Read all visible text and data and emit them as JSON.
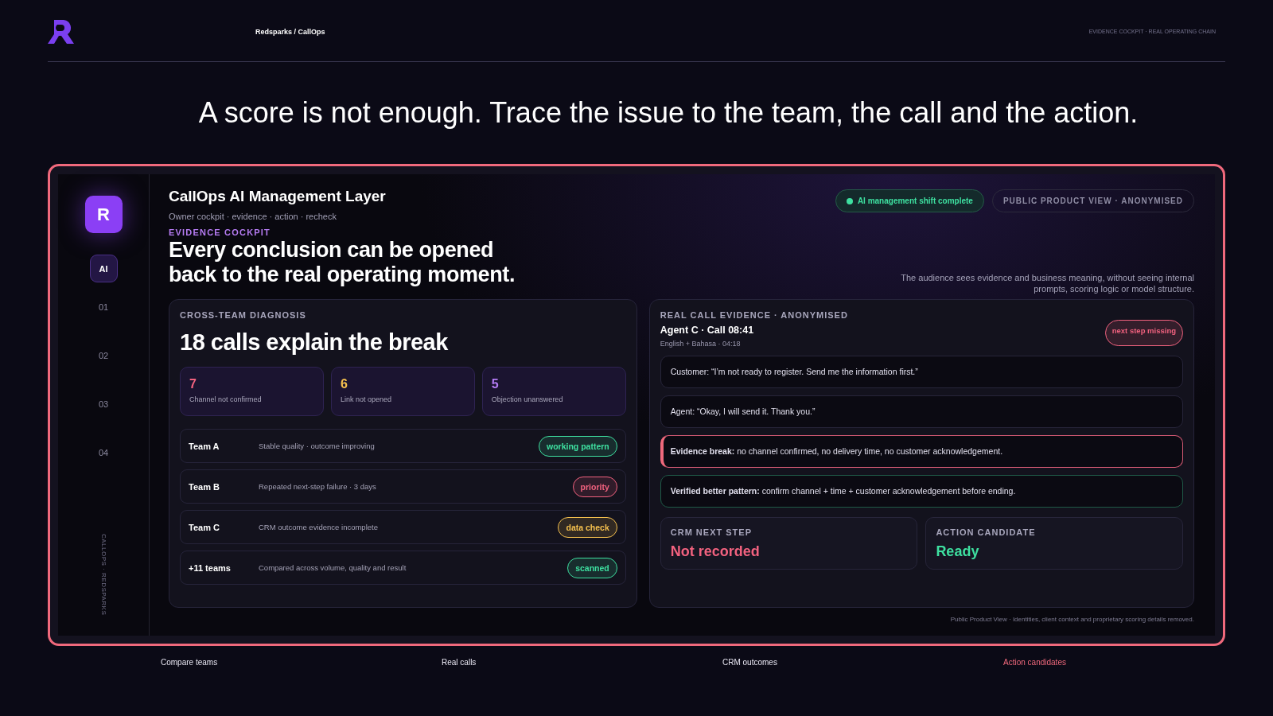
{
  "header": {
    "breadcrumb": "Redsparks / CallOps",
    "caption": "EVIDENCE COCKPIT · REAL OPERATING CHAIN"
  },
  "headline": "A score is not enough. Trace the issue to the team, the call and the action.",
  "sidebar": {
    "logo": "R",
    "items": [
      {
        "label": "AI",
        "selected": true
      },
      {
        "label": "01",
        "selected": false
      },
      {
        "label": "02",
        "selected": false
      },
      {
        "label": "03",
        "selected": false
      },
      {
        "label": "04",
        "selected": false
      }
    ],
    "vertical_caption": "CALLOPS · REDSPARKS"
  },
  "cockpit": {
    "title": "CallOps AI Management Layer",
    "subtitle": "Owner cockpit · evidence · action · recheck",
    "eyebrow": "EVIDENCE COCKPIT",
    "heading_lines": [
      "Every conclusion can be opened",
      "back to the real operating moment."
    ],
    "status_pill": {
      "label": "AI management shift complete",
      "color": "#3ee0a0"
    },
    "view_pill": "PUBLIC PRODUCT VIEW · ANONYMISED",
    "note": "The audience sees evidence and business meaning, without seeing internal prompts, scoring logic or model structure."
  },
  "diagnosis": {
    "label": "CROSS-TEAM DIAGNOSIS",
    "heading": "18 calls explain the break",
    "stats": [
      {
        "value": "7",
        "label": "Channel not confirmed",
        "color": "#f2627f"
      },
      {
        "value": "6",
        "label": "Link not opened",
        "color": "#f5c04e"
      },
      {
        "value": "5",
        "label": "Objection unanswered",
        "color": "#b57cf5"
      }
    ],
    "teams": [
      {
        "name": "Team A",
        "detail": "Stable quality · outcome improving",
        "tag": "working pattern",
        "color": "#3ee0a0"
      },
      {
        "name": "Team B",
        "detail": "Repeated next-step failure · 3 days",
        "tag": "priority",
        "color": "#f2627f"
      },
      {
        "name": "Team C",
        "detail": "CRM outcome evidence incomplete",
        "tag": "data check",
        "color": "#f5c04e"
      },
      {
        "name": "+11 teams",
        "detail": "Compared across volume, quality and result",
        "tag": "scanned",
        "color": "#3ee0a0"
      }
    ]
  },
  "evidence": {
    "label": "REAL CALL EVIDENCE · ANONYMISED",
    "call_title": "Agent C · Call 08:41",
    "call_meta": "English + Bahasa · 04:18",
    "flag": {
      "label": "next step missing",
      "color": "#f2627f"
    },
    "lines": [
      {
        "kind": "quote",
        "text": "Customer: “I’m not ready to register. Send me the information first.”"
      },
      {
        "kind": "quote",
        "text": "Agent: “Okay, I will send it. Thank you.”"
      },
      {
        "kind": "break",
        "text": "**Evidence break:** no channel confirmed, no delivery time, no customer acknowledgement."
      },
      {
        "kind": "pattern",
        "text": "**Verified better pattern:** confirm channel + time + customer acknowledgement before ending."
      }
    ],
    "outcomes": [
      {
        "label": "CRM NEXT STEP",
        "value": "Not recorded",
        "color": "#f2627f"
      },
      {
        "label": "ACTION CANDIDATE",
        "value": "Ready",
        "color": "#3ee0a0"
      }
    ]
  },
  "footnote": "Public Product View · Identities, client context and proprietary scoring details removed.",
  "tabs": [
    {
      "label": "Compare teams",
      "selected": false
    },
    {
      "label": "Real calls",
      "selected": false
    },
    {
      "label": "CRM outcomes",
      "selected": false
    },
    {
      "label": "Action candidates",
      "selected": true
    }
  ]
}
